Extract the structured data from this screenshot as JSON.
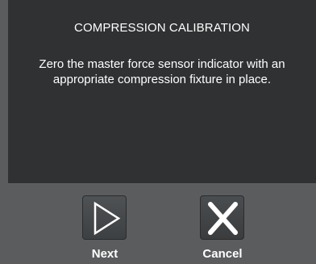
{
  "dialog": {
    "title": "COMPRESSION CALIBRATION",
    "message": "Zero the master force sensor indicator with an appropriate compression fixture in place."
  },
  "buttons": {
    "next": {
      "label": "Next",
      "icon": "play-triangle-icon"
    },
    "cancel": {
      "label": "Cancel",
      "icon": "close-x-icon"
    }
  },
  "colors": {
    "background": "#5b5c5e",
    "panel": "#2f3133",
    "text": "#ffffff",
    "icon": "#ffffff"
  }
}
